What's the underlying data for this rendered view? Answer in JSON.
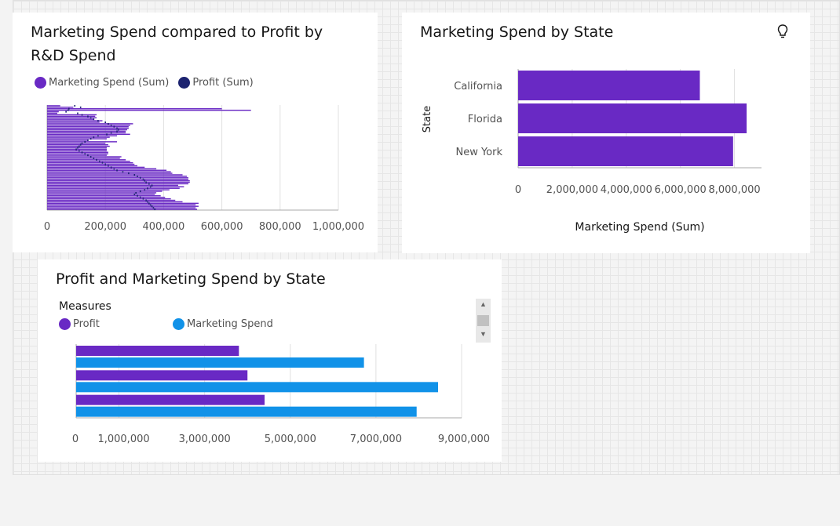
{
  "colors": {
    "purple": "#6929c4",
    "navy": "#1c2370",
    "blue": "#1192e8",
    "grid": "#e0e0e0",
    "axis": "#a8a8a8"
  },
  "card1": {
    "title": "Marketing Spend compared to Profit by R&D Spend",
    "legend": [
      "Marketing Spend (Sum)",
      "Profit (Sum)"
    ],
    "legend_colors": [
      "#6929c4",
      "#1c2370"
    ]
  },
  "card2": {
    "title": "Marketing Spend by State",
    "icon": "lightbulb-icon"
  },
  "card3": {
    "title": "Profit and Marketing Spend by State",
    "legend_title": "Measures",
    "legend": [
      "Profit",
      "Marketing Spend"
    ],
    "legend_colors": [
      "#6929c4",
      "#1192e8"
    ]
  },
  "chart_data": [
    {
      "type": "bar",
      "orientation": "horizontal",
      "title": "Marketing Spend compared to Profit by R&D Spend",
      "xlim": [
        0,
        1000000
      ],
      "xticks": [
        "0",
        "200,000",
        "400,000",
        "600,000",
        "800,000",
        "1,000,000"
      ],
      "xtick_values": [
        0,
        200000,
        400000,
        600000,
        800000,
        1000000
      ],
      "series": [
        {
          "name": "Marketing Spend (Sum)",
          "type": "bar",
          "values": [
            45000,
            90000,
            600000,
            700000,
            40000,
            35000,
            170000,
            165000,
            170000,
            160000,
            190000,
            180000,
            295000,
            285000,
            280000,
            280000,
            275000,
            270000,
            270000,
            285000,
            240000,
            215000,
            205000,
            140000,
            240000,
            200000,
            210000,
            215000,
            205000,
            205000,
            205000,
            210000,
            210000,
            205000,
            255000,
            250000,
            270000,
            285000,
            295000,
            300000,
            310000,
            335000,
            375000,
            410000,
            425000,
            430000,
            465000,
            480000,
            485000,
            485000,
            490000,
            490000,
            485000,
            450000,
            470000,
            455000,
            420000,
            395000,
            375000,
            370000,
            390000,
            405000,
            425000,
            440000,
            465000,
            520000,
            510000,
            520000,
            510000,
            515000
          ]
        },
        {
          "name": "Profit (Sum)",
          "type": "point",
          "values": [
            95000,
            115000,
            75000,
            72000,
            65000,
            105000,
            120000,
            140000,
            150000,
            160000,
            175000,
            200000,
            210000,
            220000,
            230000,
            240000,
            245000,
            240000,
            220000,
            205000,
            175000,
            160000,
            150000,
            140000,
            130000,
            120000,
            115000,
            110000,
            105000,
            100000,
            110000,
            120000,
            130000,
            140000,
            150000,
            160000,
            170000,
            180000,
            190000,
            200000,
            210000,
            220000,
            230000,
            240000,
            260000,
            280000,
            300000,
            310000,
            320000,
            330000,
            335000,
            340000,
            350000,
            360000,
            355000,
            345000,
            335000,
            320000,
            305000,
            300000,
            310000,
            320000,
            330000,
            340000,
            345000,
            350000,
            355000,
            360000,
            365000,
            370000
          ]
        }
      ]
    },
    {
      "type": "bar",
      "orientation": "horizontal",
      "title": "Marketing Spend by State",
      "categories": [
        "California",
        "Florida",
        "New York"
      ],
      "values": [
        6720000,
        8450000,
        7950000
      ],
      "xlabel": "Marketing Spend (Sum)",
      "ylabel": "State",
      "xlim": [
        0,
        9000000
      ],
      "xticks": [
        "0",
        "2,000,000",
        "4,000,000",
        "6,000,000",
        "8,000,000"
      ],
      "xtick_values": [
        0,
        2000000,
        4000000,
        6000000,
        8000000
      ]
    },
    {
      "type": "bar",
      "orientation": "horizontal",
      "title": "Profit and Marketing Spend by State",
      "categories": [
        "",
        "",
        ""
      ],
      "series": [
        {
          "name": "Profit",
          "values": [
            3800000,
            4000000,
            4400000
          ]
        },
        {
          "name": "Marketing Spend",
          "values": [
            6720000,
            8450000,
            7950000
          ]
        }
      ],
      "xlim": [
        0,
        9000000
      ],
      "xticks": [
        "0",
        "1,000,000",
        "3,000,000",
        "5,000,000",
        "7,000,000",
        "9,000,000"
      ],
      "xtick_values": [
        0,
        1000000,
        3000000,
        5000000,
        7000000,
        9000000
      ]
    }
  ]
}
